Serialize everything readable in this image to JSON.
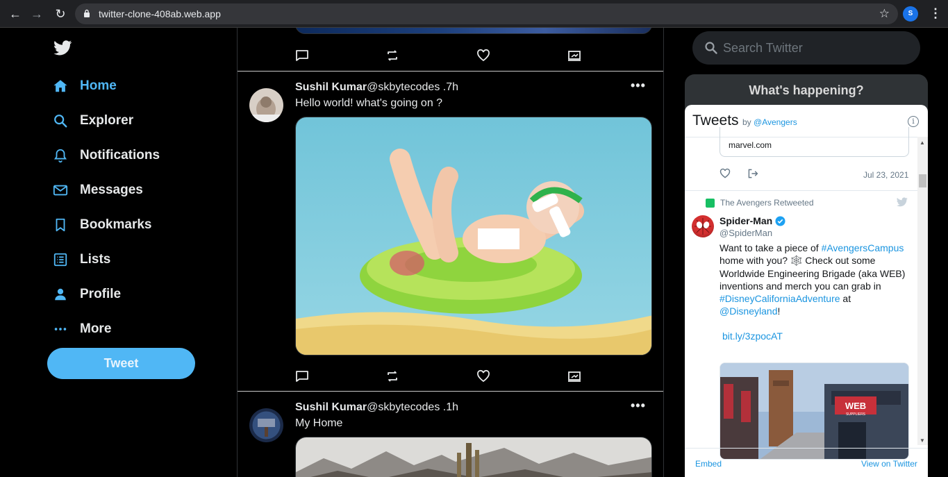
{
  "browser": {
    "url": "twitter-clone-408ab.web.app",
    "profile_initial": "S"
  },
  "sidebar": {
    "items": [
      {
        "label": "Home",
        "icon": "home-icon",
        "active": true
      },
      {
        "label": "Explorer",
        "icon": "search-icon"
      },
      {
        "label": "Notifications",
        "icon": "bell-icon"
      },
      {
        "label": "Messages",
        "icon": "mail-icon"
      },
      {
        "label": "Bookmarks",
        "icon": "bookmark-icon"
      },
      {
        "label": "Lists",
        "icon": "list-icon"
      },
      {
        "label": "Profile",
        "icon": "person-icon"
      },
      {
        "label": "More",
        "icon": "more-icon"
      }
    ],
    "tweet_button": "Tweet"
  },
  "feed": {
    "posts": [
      {
        "name": "Sushil Kumar",
        "handle": "@skbytecodes .7h",
        "text": "Hello world! what's going on ?"
      },
      {
        "name": "Sushil Kumar",
        "handle": "@skbytecodes .1h",
        "text": "My Home"
      }
    ]
  },
  "right": {
    "search_placeholder": "Search Twitter",
    "happening_title": "What's happening?",
    "widget": {
      "title": "Tweets",
      "by": "by",
      "by_account": "@Avengers",
      "card_domain": "marvel.com",
      "date": "Jul 23, 2021",
      "retweeted": "The Avengers Retweeted",
      "author_name": "Spider-Man",
      "author_handle": "@SpiderMan",
      "text_1": "Want to take a piece of ",
      "tag_1": "#AvengersCampus",
      "text_2": " home with you? 🕸️ Check out some Worldwide Engineering Brigade (aka WEB) inventions and merch you can grab in ",
      "tag_2": "#DisneyCaliforniaAdventure",
      "text_3": " at ",
      "mention": "@Disneyland",
      "text_4": "!",
      "link": "bit.ly/3zpocAT",
      "image_sign": "WEB",
      "image_sign_sub": "SUPPLIERS",
      "embed": "Embed",
      "view_on_twitter": "View on Twitter"
    }
  },
  "colors": {
    "accent": "#50b7f5",
    "link": "#1b95e0",
    "background": "#000000"
  }
}
